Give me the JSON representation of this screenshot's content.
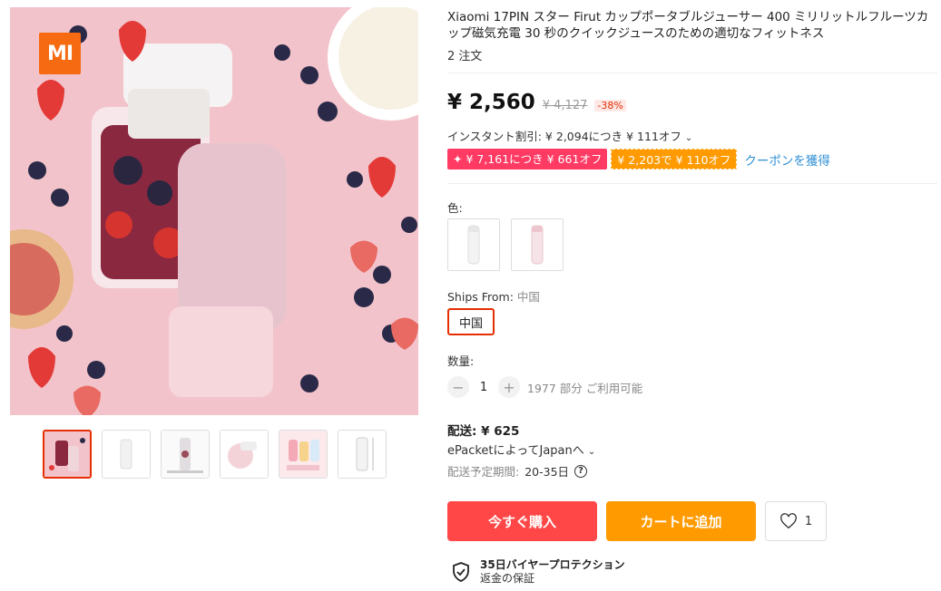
{
  "gallery": {
    "logo_text": "MI",
    "thumbnail_count": 6,
    "active_index": 0
  },
  "product": {
    "title": "Xiaomi 17PIN スター Firut カップポータブルジューサー 400 ミリリットルフルーツカップ磁気充電 30 秒のクイックジュースのための適切なフィットネス",
    "orders": "2 注文"
  },
  "pricing": {
    "price": "¥ 2,560",
    "original_price": "¥ 4,127",
    "discount": "-38%",
    "instant_discount": "インスタント割引: ¥ 2,094につき ¥ 111オフ",
    "coupon_pink": "✦ ¥ 7,161につき ¥ 661オフ",
    "coupon_orange": "¥ 2,203で ¥ 110オフ",
    "coupon_link": "クーポンを獲得"
  },
  "options": {
    "color_label": "色:",
    "ships_from_label": "Ships From:",
    "ships_from_value": "中国",
    "ships_from_option": "中国",
    "quantity_label": "数量:",
    "quantity_value": "1",
    "quantity_available": "1977 部分 ご利用可能",
    "minus": "−",
    "plus": "+"
  },
  "shipping": {
    "cost": "配送: ¥ 625",
    "method": "ePacketによってJapanへ",
    "eta_label": "配送予定期間:",
    "eta_value": "20-35日"
  },
  "actions": {
    "buy_now": "今すぐ購入",
    "add_to_cart": "カートに追加",
    "wishlist_count": "1"
  },
  "protection": {
    "title": "35日バイヤープロテクション",
    "subtitle": "返金の保証"
  },
  "colors": {
    "buy": "#ff4747",
    "cart": "#ff9a00",
    "coupon_pink": "#ff3b64",
    "link": "#2e8fd4",
    "image_bg": "#f3c3cb"
  }
}
